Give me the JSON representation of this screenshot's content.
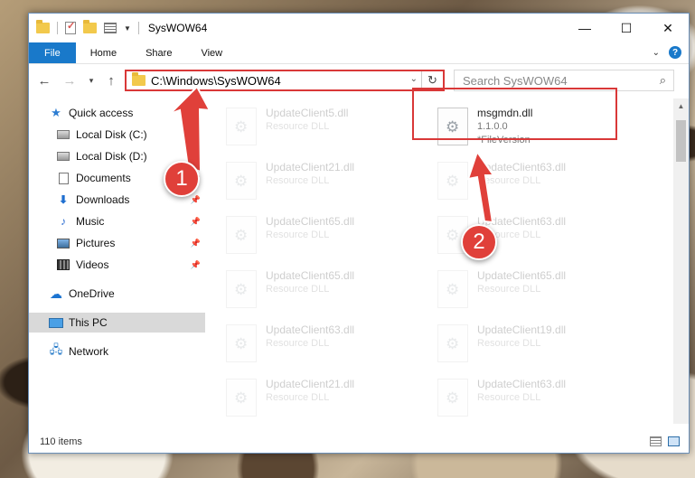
{
  "window": {
    "title": "SysWOW64",
    "controls": {
      "minimize": "—",
      "maximize": "☐",
      "close": "✕"
    }
  },
  "ribbon": {
    "tabs": [
      "File",
      "Home",
      "Share",
      "View"
    ],
    "help": "?"
  },
  "nav": {
    "back": "←",
    "forward": "→",
    "up": "↑",
    "address": "C:\\Windows\\SysWOW64",
    "search_placeholder": "Search SysWOW64"
  },
  "sidebar": {
    "items": [
      {
        "label": "Quick access",
        "icon": "star-icon"
      },
      {
        "label": "Local Disk (C:)",
        "icon": "disk-icon"
      },
      {
        "label": "Local Disk (D:)",
        "icon": "disk-icon"
      },
      {
        "label": "Documents",
        "icon": "documents-icon"
      },
      {
        "label": "Downloads",
        "icon": "downloads-icon"
      },
      {
        "label": "Music",
        "icon": "music-icon"
      },
      {
        "label": "Pictures",
        "icon": "pictures-icon"
      },
      {
        "label": "Videos",
        "icon": "videos-icon"
      },
      {
        "label": "OneDrive",
        "icon": "onedrive-icon"
      },
      {
        "label": "This PC",
        "icon": "pc-icon"
      },
      {
        "label": "Network",
        "icon": "network-icon"
      }
    ]
  },
  "files": {
    "left": [
      {
        "name": "UpdateClient5.dll",
        "type": "Resource DLL"
      },
      {
        "name": "UpdateClient21.dll",
        "type": "Resource DLL"
      },
      {
        "name": "UpdateClient65.dll",
        "type": "Resource DLL"
      },
      {
        "name": "UpdateClient65.dll",
        "type": "Resource DLL"
      },
      {
        "name": "UpdateClient63.dll",
        "type": "Resource DLL"
      },
      {
        "name": "UpdateClient21.dll",
        "type": "Resource DLL"
      }
    ],
    "right": [
      {
        "name": "msgmdn.dll",
        "type": "1.1.0.0",
        "extra": "*FileVersion"
      },
      {
        "name": "UpdateClient63.dll",
        "type": "Resource DLL"
      },
      {
        "name": "UpdateClient63.dll",
        "type": "Resource DLL"
      },
      {
        "name": "UpdateClient65.dll",
        "type": "Resource DLL"
      },
      {
        "name": "UpdateClient19.dll",
        "type": "Resource DLL"
      },
      {
        "name": "UpdateClient63.dll",
        "type": "Resource DLL"
      }
    ]
  },
  "status": {
    "count": "110 items"
  },
  "annotations": {
    "step1": "1",
    "step2": "2"
  },
  "colors": {
    "accent": "#1979ca",
    "highlight": "#d93838",
    "badge": "#e0403a"
  }
}
